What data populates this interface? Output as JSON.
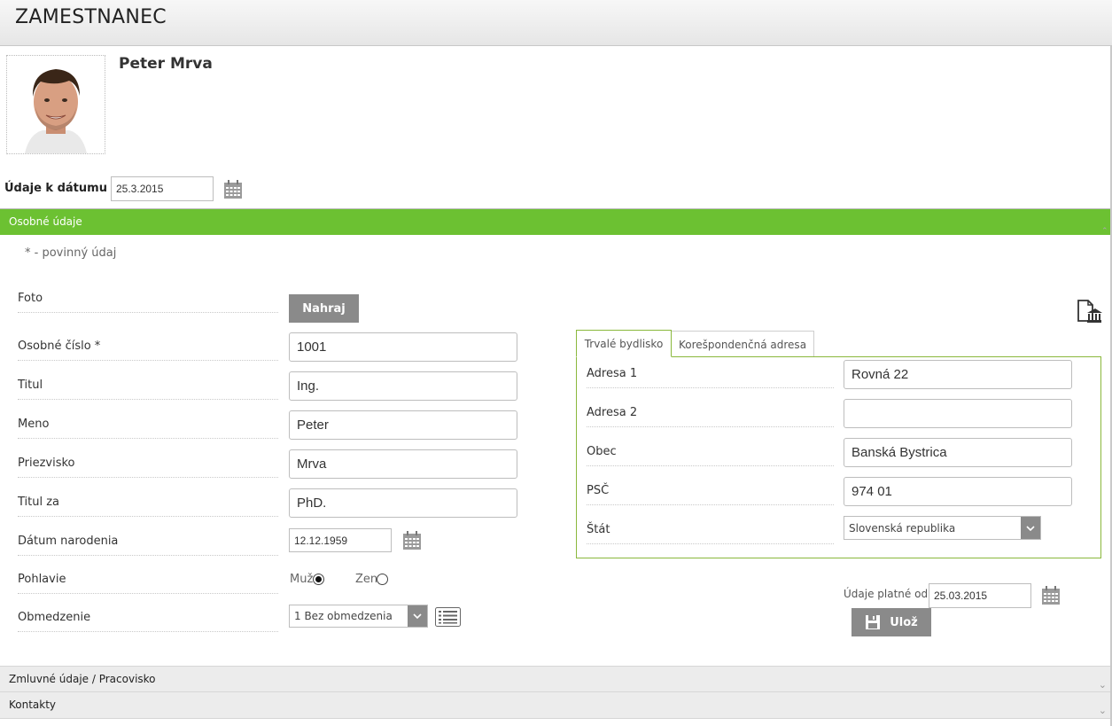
{
  "header": {
    "title": "ZAMESTNANEC"
  },
  "employee": {
    "name": "Peter Mrva",
    "photo_icon": "employee-photo"
  },
  "date_filter": {
    "label": "Údaje k dátumu",
    "value": "25.3.2015",
    "icon": "calendar-icon"
  },
  "section_personal": {
    "title": "Osobné údaje",
    "required_hint": "* - povinný údaj",
    "fields": {
      "photo_label": "Foto",
      "upload_button": "Nahraj",
      "personal_number_label": "Osobné číslo *",
      "personal_number_value": "1001",
      "title_label": "Titul",
      "title_value": "Ing.",
      "first_name_label": "Meno",
      "first_name_value": "Peter",
      "last_name_label": "Priezvisko",
      "last_name_value": "Mrva",
      "title_after_label": "Titul za",
      "title_after_value": "PhD.",
      "birth_date_label": "Dátum narodenia",
      "birth_date_value": "12.12.1959",
      "gender_label": "Pohlavie",
      "gender_male": "Muž",
      "gender_female": "Žena",
      "gender_selected": "Muž",
      "restriction_label": "Obmedzenie",
      "restriction_value": "1 Bez obmedzenia"
    }
  },
  "address": {
    "tabs": [
      {
        "label": "Trvalé bydlisko",
        "active": true
      },
      {
        "label": "Korešpondenčná adresa",
        "active": false
      }
    ],
    "address1_label": "Adresa 1",
    "address1_value": "Rovná 22",
    "address2_label": "Adresa 2",
    "address2_value": "",
    "city_label": "Obec",
    "city_value": "Banská Bystrica",
    "zip_label": "PSČ",
    "zip_value": "974 01",
    "country_label": "Štát",
    "country_value": "Slovenská republika"
  },
  "validity": {
    "label": "Údaje platné od:",
    "value": "25.03.2015",
    "save_button": "Ulož"
  },
  "collapsed_sections": [
    {
      "title": "Zmluvné údaje / Pracovisko"
    },
    {
      "title": "Kontakty"
    }
  ],
  "colors": {
    "accent": "#6cc132",
    "panel_border": "#8ab83c",
    "button_gray": "#8a8a8a"
  }
}
